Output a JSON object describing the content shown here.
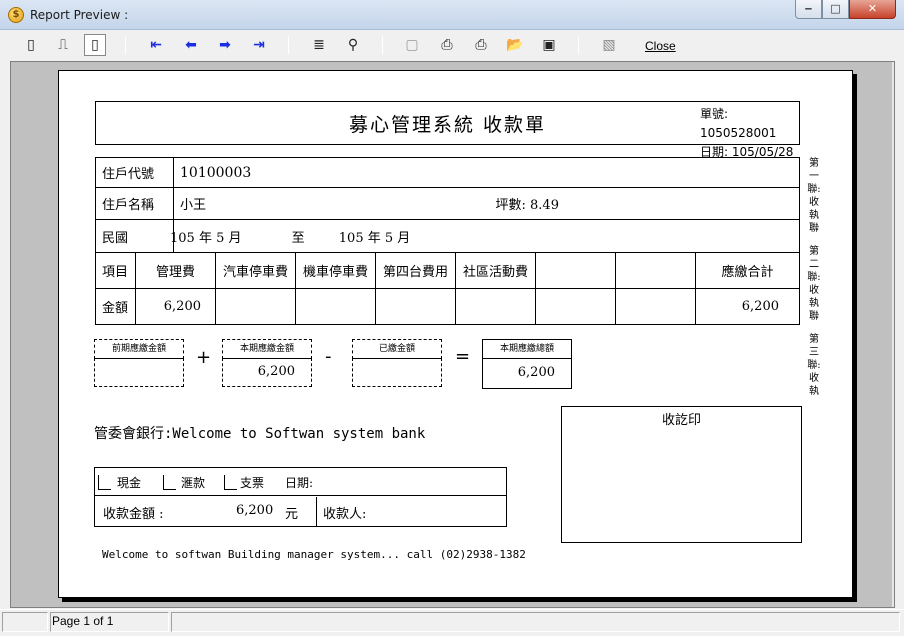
{
  "window": {
    "title": "Report Preview :",
    "icon": "app-icon",
    "controls": [
      "minimize-icon",
      "maximize-icon",
      "close-icon"
    ]
  },
  "toolbar": {
    "buttons": [
      {
        "name": "single-page-icon",
        "glyph": "▯"
      },
      {
        "name": "two-page-icon",
        "glyph": "⎍"
      },
      {
        "name": "multi-page-icon",
        "glyph": "▭"
      },
      {
        "name": "first-page-icon",
        "glyph": "⇤"
      },
      {
        "name": "prev-page-icon",
        "glyph": "⇐"
      },
      {
        "name": "next-page-icon",
        "glyph": "⇒"
      },
      {
        "name": "last-page-icon",
        "glyph": "⇥"
      },
      {
        "name": "goto-page-icon",
        "glyph": "≡"
      },
      {
        "name": "find-icon",
        "glyph": "⚲"
      },
      {
        "name": "page-setup-icon",
        "glyph": "▢"
      },
      {
        "name": "print-setup-icon",
        "glyph": "⎙"
      },
      {
        "name": "print-icon",
        "glyph": "⎙"
      },
      {
        "name": "open-icon",
        "glyph": "⌂"
      },
      {
        "name": "save-icon",
        "glyph": "▣"
      },
      {
        "name": "export-icon",
        "glyph": "▧"
      }
    ],
    "close_label": "Close"
  },
  "report": {
    "title": "募心管理系統 收款單",
    "slip_no_label": "單號:",
    "slip_no": "1050528001",
    "date_label": "日期:",
    "date": "105/05/28",
    "household_code_label": "住戶代號",
    "household_code": "10100003",
    "household_name_label": "住戶名稱",
    "household_name": "小王",
    "area_label": "坪數:",
    "area": "8.49",
    "period_label": "民國",
    "period_from": "105 年  5  月",
    "period_to_label": "至",
    "period_to": "105 年  5  月",
    "items_label": "項目",
    "items": [
      "管理費",
      "汽車停車費",
      "機車停車費",
      "第四台費用",
      "社區活動費",
      "",
      ""
    ],
    "total_label": "應繳合計",
    "amount_label": "金額",
    "amounts": [
      "6,200",
      "",
      "",
      "",
      "",
      "",
      ""
    ],
    "total_amount": "6,200",
    "side_labels": [
      "第一聯:收執聯",
      "第二聯:收執聯",
      "第三聯:收執"
    ],
    "calc": {
      "prev_due_label": "前期應繳金額",
      "prev_due": "",
      "current_due_label": "本期應繳金額",
      "current_due": "6,200",
      "paid_label": "已繳金額",
      "paid": "",
      "total_due_label": "本期應繳總額",
      "total_due": "6,200",
      "plus": "+",
      "minus": "-",
      "equals": "="
    },
    "bank_line": "管委會銀行:Welcome to Softwan system bank",
    "stamp_label": "收訖印",
    "payment": {
      "cash": "現金",
      "transfer": "滙款",
      "check": "支票",
      "date_label": "日期:",
      "amount_label": "收款金額 :",
      "amount": "6,200",
      "currency": "元",
      "receiver_label": "收款人:"
    },
    "footer_note": "Welcome to softwan Building manager system... call (02)2938-1382"
  },
  "status": {
    "page_text": "Page 1 of 1"
  }
}
